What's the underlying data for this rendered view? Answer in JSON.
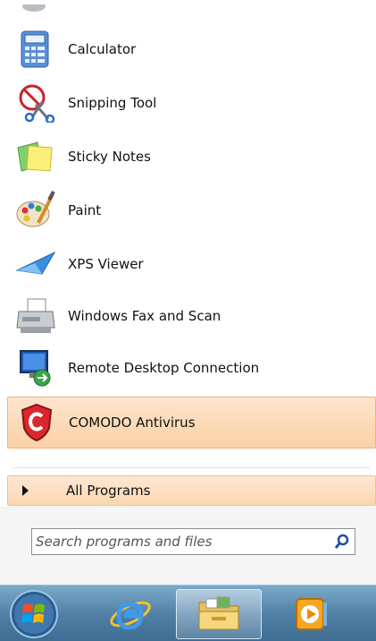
{
  "start_menu": {
    "items": [
      {
        "label": "Calculator",
        "icon": "calculator-icon"
      },
      {
        "label": "Snipping Tool",
        "icon": "snipping-tool-icon"
      },
      {
        "label": "Sticky Notes",
        "icon": "sticky-notes-icon"
      },
      {
        "label": "Paint",
        "icon": "paint-icon"
      },
      {
        "label": "XPS Viewer",
        "icon": "xps-viewer-icon"
      },
      {
        "label": "Windows Fax and Scan",
        "icon": "fax-scan-icon"
      },
      {
        "label": "Remote Desktop Connection",
        "icon": "remote-desktop-icon"
      },
      {
        "label": "COMODO Antivirus",
        "icon": "comodo-icon",
        "highlighted": true
      }
    ],
    "all_programs_label": "All Programs",
    "search": {
      "placeholder": "Search programs and files",
      "value": ""
    }
  },
  "taskbar": {
    "items": [
      {
        "icon": "start-orb-icon"
      },
      {
        "icon": "internet-explorer-icon"
      },
      {
        "icon": "windows-explorer-icon",
        "active": true
      },
      {
        "icon": "media-player-icon"
      }
    ]
  },
  "colors": {
    "highlight": "#f9d1a6",
    "taskbar": "#4f7ea5"
  }
}
